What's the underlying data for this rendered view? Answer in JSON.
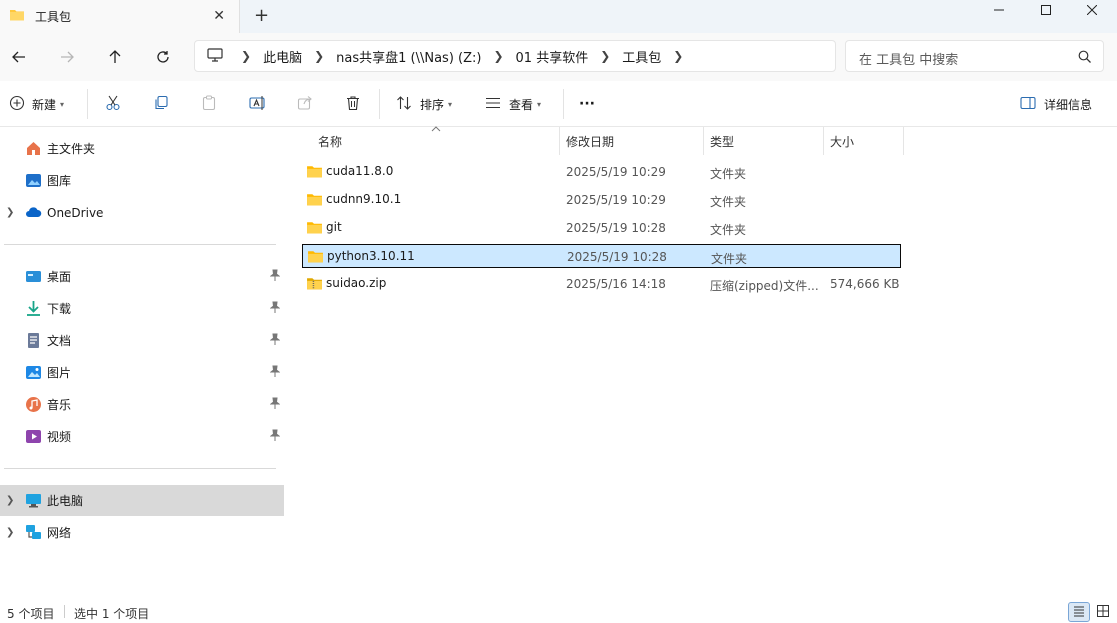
{
  "window": {
    "tab_title": "工具包",
    "tab_icon": "folder-icon",
    "close_glyph": "✕",
    "new_tab_glyph": "+"
  },
  "address": {
    "breadcrumbs": [
      "此电脑",
      "nas共享盘1 (\\\\Nas) (Z:)",
      "01 共享软件",
      "工具包"
    ]
  },
  "search": {
    "placeholder": "在 工具包 中搜索"
  },
  "toolbar": {
    "new_label": "新建",
    "sort_label": "排序",
    "view_label": "查看",
    "more_label": "···",
    "details_label": "详细信息"
  },
  "sidebar": {
    "items": [
      {
        "label": "主文件夹",
        "icon": "home-icon"
      },
      {
        "label": "图库",
        "icon": "gallery-icon"
      },
      {
        "label": "OneDrive",
        "icon": "cloud-icon"
      },
      {
        "label": "桌面",
        "icon": "desktop-icon"
      },
      {
        "label": "下载",
        "icon": "download-icon"
      },
      {
        "label": "文档",
        "icon": "document-icon"
      },
      {
        "label": "图片",
        "icon": "pictures-icon"
      },
      {
        "label": "音乐",
        "icon": "music-icon"
      },
      {
        "label": "视频",
        "icon": "video-icon"
      },
      {
        "label": "此电脑",
        "icon": "computer-icon"
      },
      {
        "label": "网络",
        "icon": "network-icon"
      }
    ]
  },
  "columns": {
    "name": "名称",
    "modified": "修改日期",
    "type": "类型",
    "size": "大小"
  },
  "files": [
    {
      "name": "cuda11.8.0",
      "modified": "2025/5/19 10:29",
      "type": "文件夹",
      "size": "",
      "icon": "folder-icon"
    },
    {
      "name": "cudnn9.10.1",
      "modified": "2025/5/19 10:29",
      "type": "文件夹",
      "size": "",
      "icon": "folder-icon"
    },
    {
      "name": "git",
      "modified": "2025/5/19 10:28",
      "type": "文件夹",
      "size": "",
      "icon": "folder-icon"
    },
    {
      "name": "python3.10.11",
      "modified": "2025/5/19 10:28",
      "type": "文件夹",
      "size": "",
      "icon": "folder-icon",
      "selected": true
    },
    {
      "name": "suidao.zip",
      "modified": "2025/5/16 14:18",
      "type": "压缩(zipped)文件...",
      "size": "574,666 KB",
      "icon": "zip-folder-icon"
    }
  ],
  "status": {
    "item_count": "5 个项目",
    "selection": "选中 1 个项目"
  },
  "colors": {
    "accent": "#0067c0",
    "selection": "#cce8ff",
    "folder": "#ffc83d",
    "sidebar_selected": "#d9d9d9"
  }
}
